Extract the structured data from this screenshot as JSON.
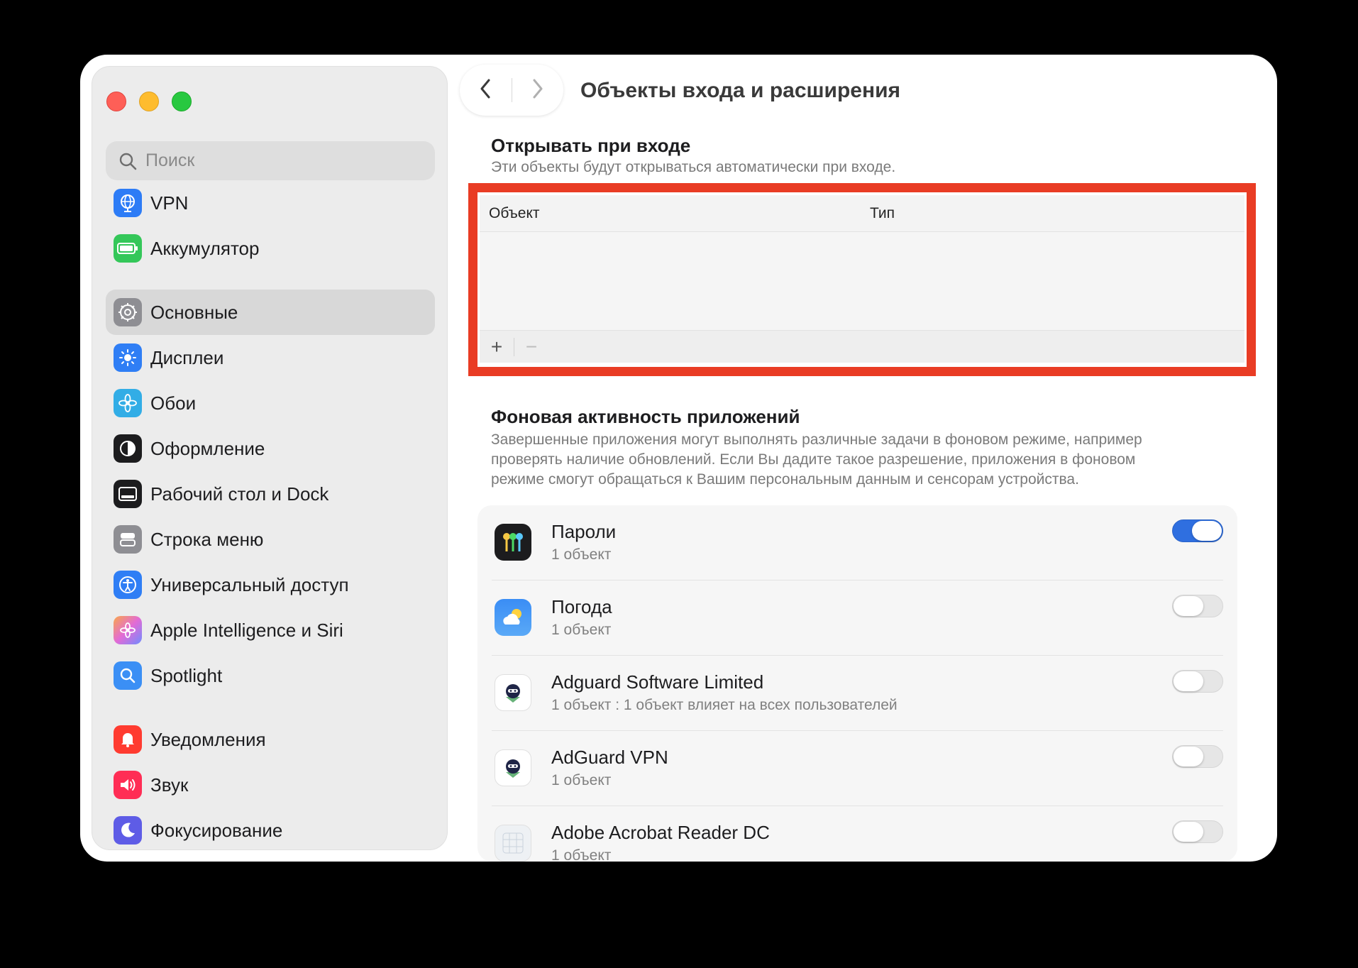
{
  "window": {
    "title": "Объекты входа и расширения"
  },
  "sidebar": {
    "search": {
      "placeholder": "Поиск",
      "value": ""
    },
    "items": [
      {
        "label": "VPN",
        "icon": "globe-icon",
        "color": "#2d7cf6"
      },
      {
        "label": "Аккумулятор",
        "icon": "battery-icon",
        "color": "#34c759"
      },
      {
        "label": "Основные",
        "icon": "gear-icon",
        "color": "#8e8e93",
        "selected": true
      },
      {
        "label": "Дисплеи",
        "icon": "sun-icon",
        "color": "#2f7ef5"
      },
      {
        "label": "Обои",
        "icon": "flower-icon",
        "color": "#32ade6"
      },
      {
        "label": "Оформление",
        "icon": "contrast-icon",
        "color": "#1c1c1e"
      },
      {
        "label": "Рабочий стол и Dock",
        "icon": "dock-icon",
        "color": "#1c1c1e"
      },
      {
        "label": "Строка меню",
        "icon": "menubar-icon",
        "color": "#8e8e93"
      },
      {
        "label": "Универсальный доступ",
        "icon": "accessibility-icon",
        "color": "#2f7ef5"
      },
      {
        "label": "Apple Intelligence и Siri",
        "icon": "siri-icon",
        "color": "#e26bd6"
      },
      {
        "label": "Spotlight",
        "icon": "magnifier-icon",
        "color": "#3b8ff5"
      },
      {
        "label": "Уведомления",
        "icon": "bell-icon",
        "color": "#ff3b30"
      },
      {
        "label": "Звук",
        "icon": "speaker-icon",
        "color": "#ff2d55"
      },
      {
        "label": "Фокусирование",
        "icon": "moon-icon",
        "color": "#5e5ce6"
      }
    ]
  },
  "login_items": {
    "title": "Открывать при входе",
    "description": "Эти объекты будут открываться автоматически при входе.",
    "columns": [
      "Объект",
      "Тип"
    ],
    "rows": [],
    "add_label": "+",
    "remove_label": "−"
  },
  "background": {
    "title": "Фоновая активность приложений",
    "description": [
      "Завершенные приложения могут выполнять различные задачи в фоновом режиме, например",
      "проверять наличие обновлений. Если Вы дадите такое разрешение, приложения в фоновом",
      "режиме смогут обращаться к Вашим персональным данным и сенсорам устройства."
    ],
    "apps": [
      {
        "name": "Пароли",
        "sub": "1 объект",
        "enabled": true,
        "icon": "passwords-keys-icon"
      },
      {
        "name": "Погода",
        "sub": "1 объект",
        "enabled": false,
        "icon": "weather-icon"
      },
      {
        "name": "Adguard Software Limited",
        "sub": "1 объект : 1 объект влияет на всех пользователей",
        "enabled": false,
        "icon": "adguard-icon"
      },
      {
        "name": "AdGuard VPN",
        "sub": "1 объект",
        "enabled": false,
        "icon": "adguard-vpn-icon"
      },
      {
        "name": "Adobe Acrobat Reader DC",
        "sub": "1 объект",
        "enabled": false,
        "icon": "acrobat-icon"
      }
    ]
  },
  "colors": {
    "highlight": "#e93c24",
    "toggle_on": "#2f6fe0"
  }
}
